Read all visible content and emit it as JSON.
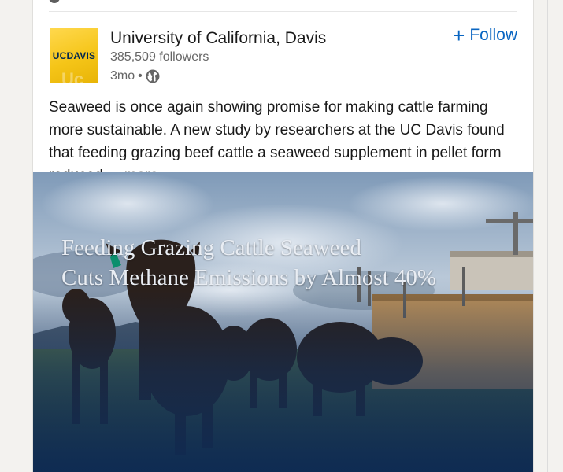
{
  "post": {
    "author": {
      "name": "University of California, Davis",
      "followers": "385,509 followers",
      "age": "3mo",
      "separator": "•",
      "logo": {
        "text": "UCDAVIS",
        "color": "#f5c518"
      }
    },
    "follow_label": "Follow",
    "follow_icon": "plus-icon",
    "visibility_icon": "globe-icon",
    "text": "Seaweed is once again showing promise for making cattle farming more sustainable. A new study by researchers at the UC Davis found that feeding grazing beef cattle a seaweed supplement in pellet form reduced",
    "more_label": "...more",
    "image": {
      "headline_line1": "Feeding Grazing Cattle Seaweed",
      "headline_line2": "Cuts Methane Emissions by Almost 40%"
    }
  },
  "colors": {
    "accent": "#0a66c2",
    "text_primary": "#191919",
    "text_secondary": "#666666"
  }
}
